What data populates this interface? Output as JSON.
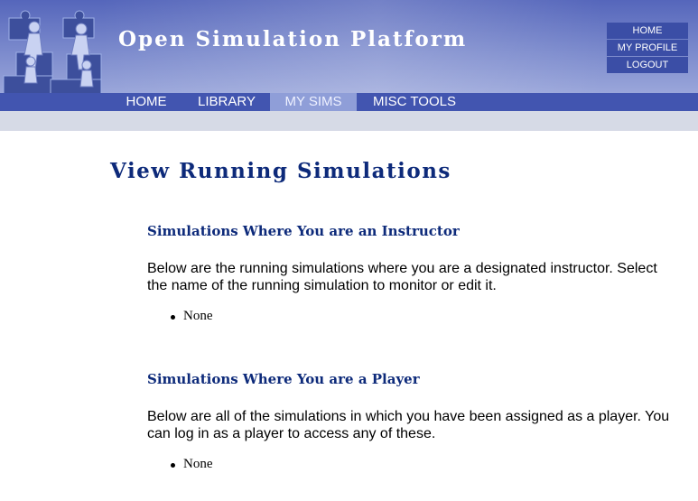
{
  "header": {
    "site_title": "Open Simulation Platform",
    "logo_icon": "puzzle-figures-logo"
  },
  "user_menu": {
    "home": "HOME",
    "profile": "MY PROFILE",
    "logout": "LOGOUT"
  },
  "nav": {
    "items": [
      {
        "label": "HOME",
        "active": false
      },
      {
        "label": "LIBRARY",
        "active": false
      },
      {
        "label": "MY SIMS",
        "active": true
      },
      {
        "label": "MISC TOOLS",
        "active": false
      }
    ]
  },
  "main": {
    "page_title": "View Running Simulations",
    "instructor": {
      "heading": "Simulations Where You are an Instructor",
      "text": "Below are the running simulations where you are a designated instructor. Select the name of the running simulation to monitor or edit it.",
      "items": [
        "None"
      ]
    },
    "player": {
      "heading": "Simulations Where You are a Player",
      "text": "Below are all of the simulations in which you have been assigned as a player. You can log in as a player to access any of these.",
      "items": [
        "None"
      ]
    }
  },
  "colors": {
    "accent": "#0d2a7a",
    "nav_bg": "#4255b0",
    "nav_active": "#8f9ed8",
    "subbar": "#d6dae6"
  }
}
